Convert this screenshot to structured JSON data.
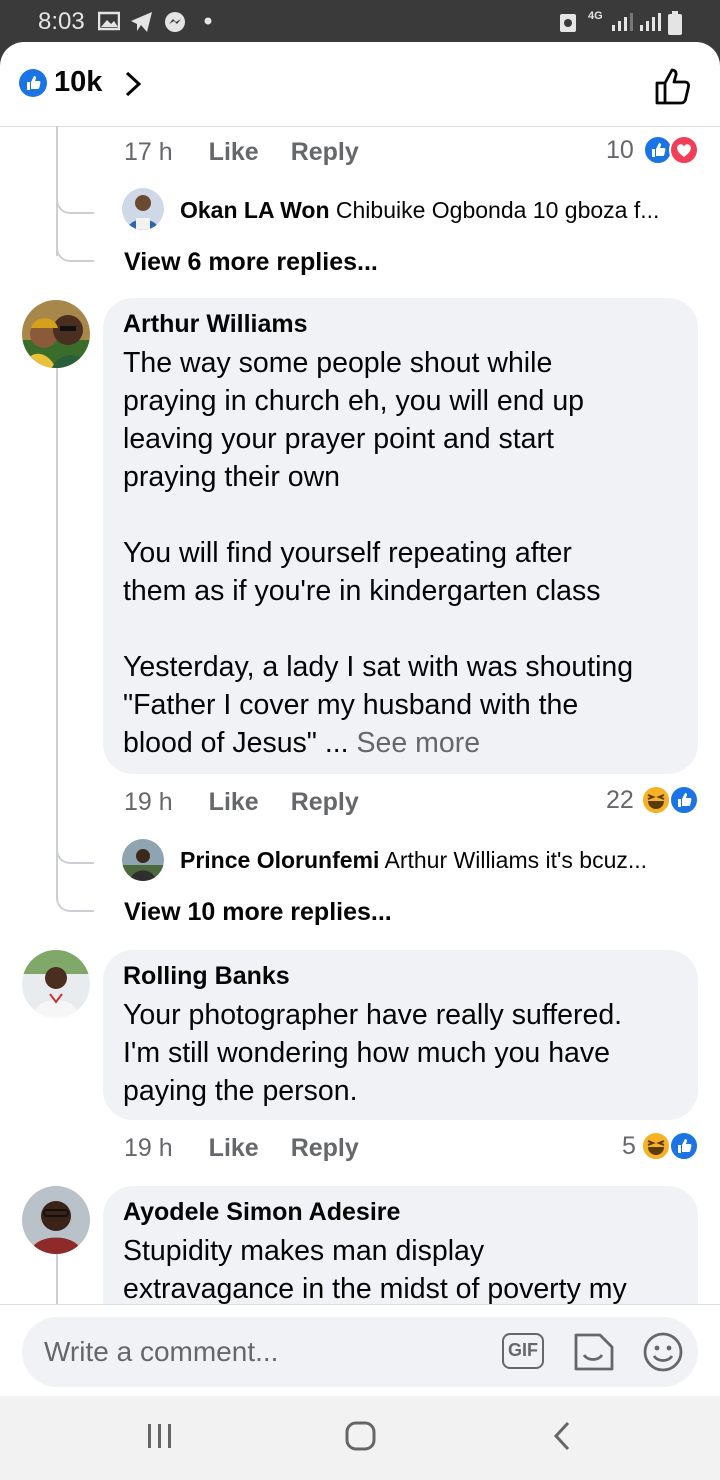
{
  "status": {
    "time": "8:03",
    "network": "4G"
  },
  "header": {
    "like_count": "10k"
  },
  "comments": [
    {
      "time": "17 h",
      "like": "Like",
      "reply": "Reply",
      "reaction_count": "10",
      "reply_preview": {
        "author": "Okan LA Won",
        "text": "Chibuike Ogbonda 10 gboza f..."
      },
      "view_more": "View 6 more replies..."
    },
    {
      "author": "Arthur Williams",
      "text": "The way some people shout while\npraying in church eh, you will end up\nleaving your prayer point and start\npraying their own\n\nYou will find yourself repeating after\nthem as if you're in kindergarten class\n\nYesterday, a lady I sat with was shouting\n\"Father I cover my husband with the\nblood of Jesus\" ...",
      "see_more": "See more",
      "time": "19 h",
      "like": "Like",
      "reply": "Reply",
      "reaction_count": "22",
      "reply_preview": {
        "author": "Prince Olorunfemi",
        "text": "Arthur Williams it's bcuz..."
      },
      "view_more": "View 10 more replies..."
    },
    {
      "author": "Rolling Banks",
      "text": "Your photographer have really suffered.\nI'm still wondering how much you have\npaying the person.",
      "time": "19 h",
      "like": "Like",
      "reply": "Reply",
      "reaction_count": "5"
    },
    {
      "author": "Ayodele Simon Adesire",
      "text": "Stupidity makes man display\nextravagance in the midst of poverty my"
    }
  ],
  "composer": {
    "placeholder": "Write a comment...",
    "gif_label": "GIF"
  },
  "colors": {
    "accent": "#1b74e4",
    "bubble": "#f0f2f5",
    "muted": "#65676b"
  }
}
